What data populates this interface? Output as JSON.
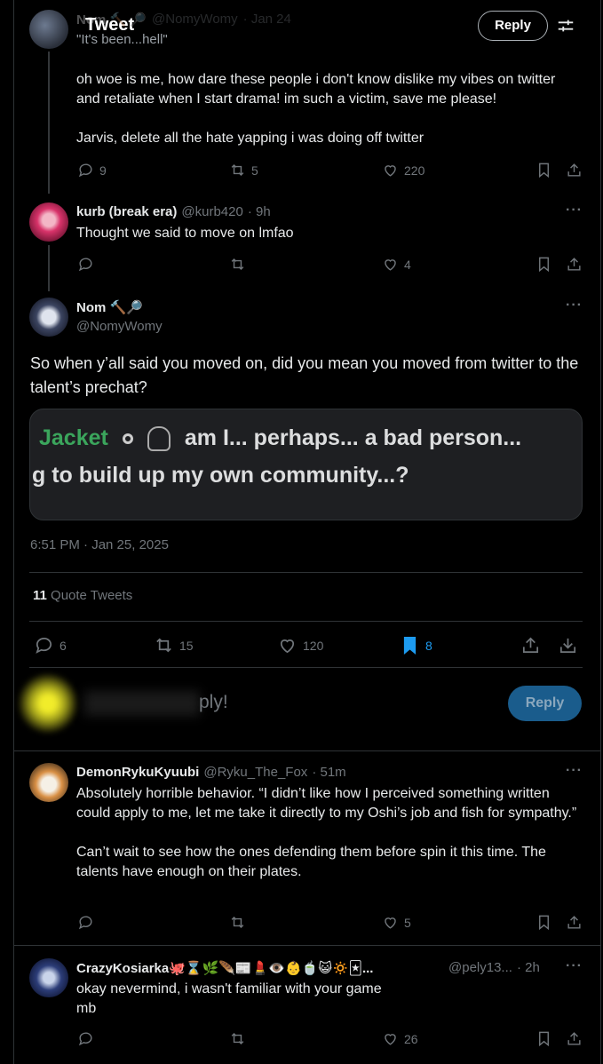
{
  "header": {
    "title": "Tweet",
    "reply_button": "Reply"
  },
  "tweets": [
    {
      "name": "Nom 🔨 🔎",
      "handle": "@NomyWomy",
      "time": "· Jan 24",
      "quote_line": "\"It's been...hell\"",
      "body": "oh woe is me, how dare these people i don't know dislike my vibes on twitter and retaliate when I start drama! im such a victim, save me please!\n\nJarvis, delete all the hate yapping i was doing off twitter",
      "replies": "9",
      "retweets": "5",
      "likes": "220"
    },
    {
      "name": "kurb (break era)",
      "handle": "@kurb420",
      "time": "· 9h",
      "body": "Thought we said to move on lmfao",
      "replies": "",
      "retweets": "",
      "likes": "4"
    }
  ],
  "main_tweet": {
    "name": "Nom 🔨🔎",
    "handle": "@NomyWomy",
    "body": "So when y’all said you moved on, did you mean you moved from twitter to the talent’s prechat?",
    "image_line1_green": "Jacket",
    "image_line1_rest": "am I... perhaps... a bad person...",
    "image_line2": "g to build up my own community...?",
    "timestamp": "6:51 PM · Jan 25, 2025",
    "quote_count": "11",
    "quote_label": "Quote Tweets",
    "replies": "6",
    "retweets": "15",
    "likes": "120",
    "bookmarks": "8"
  },
  "composer": {
    "placeholder_tail": "ply!",
    "button": "Reply"
  },
  "replies": [
    {
      "name": "DemonRykuKyuubi",
      "handle": "@Ryku_The_Fox",
      "time": "· 51m",
      "body": "Absolutely horrible behavior. “I didn’t like how I perceived something written could apply to me, let me take it directly to my Oshi’s job and fish for sympathy.”\n\nCan’t wait to see how the ones defending them before spin it this time. The talents have enough on their plates.",
      "replies": "",
      "retweets": "",
      "likes": "5"
    },
    {
      "name": "CrazyKosiarka🐙⌛🌿🪶📰💄👁️👶🍵😺🔅🃏...",
      "handle": "@pely13...",
      "time": "· 2h",
      "body": "okay nevermind, i wasn't familiar with your game\nmb",
      "replies": "",
      "retweets": "",
      "likes": "26"
    }
  ],
  "colors": {
    "accent": "#1d9bf0",
    "reply_button_bg": "#1a5c8c",
    "text": "#e7e9ea",
    "muted": "#71767b",
    "border": "#2f3336"
  }
}
